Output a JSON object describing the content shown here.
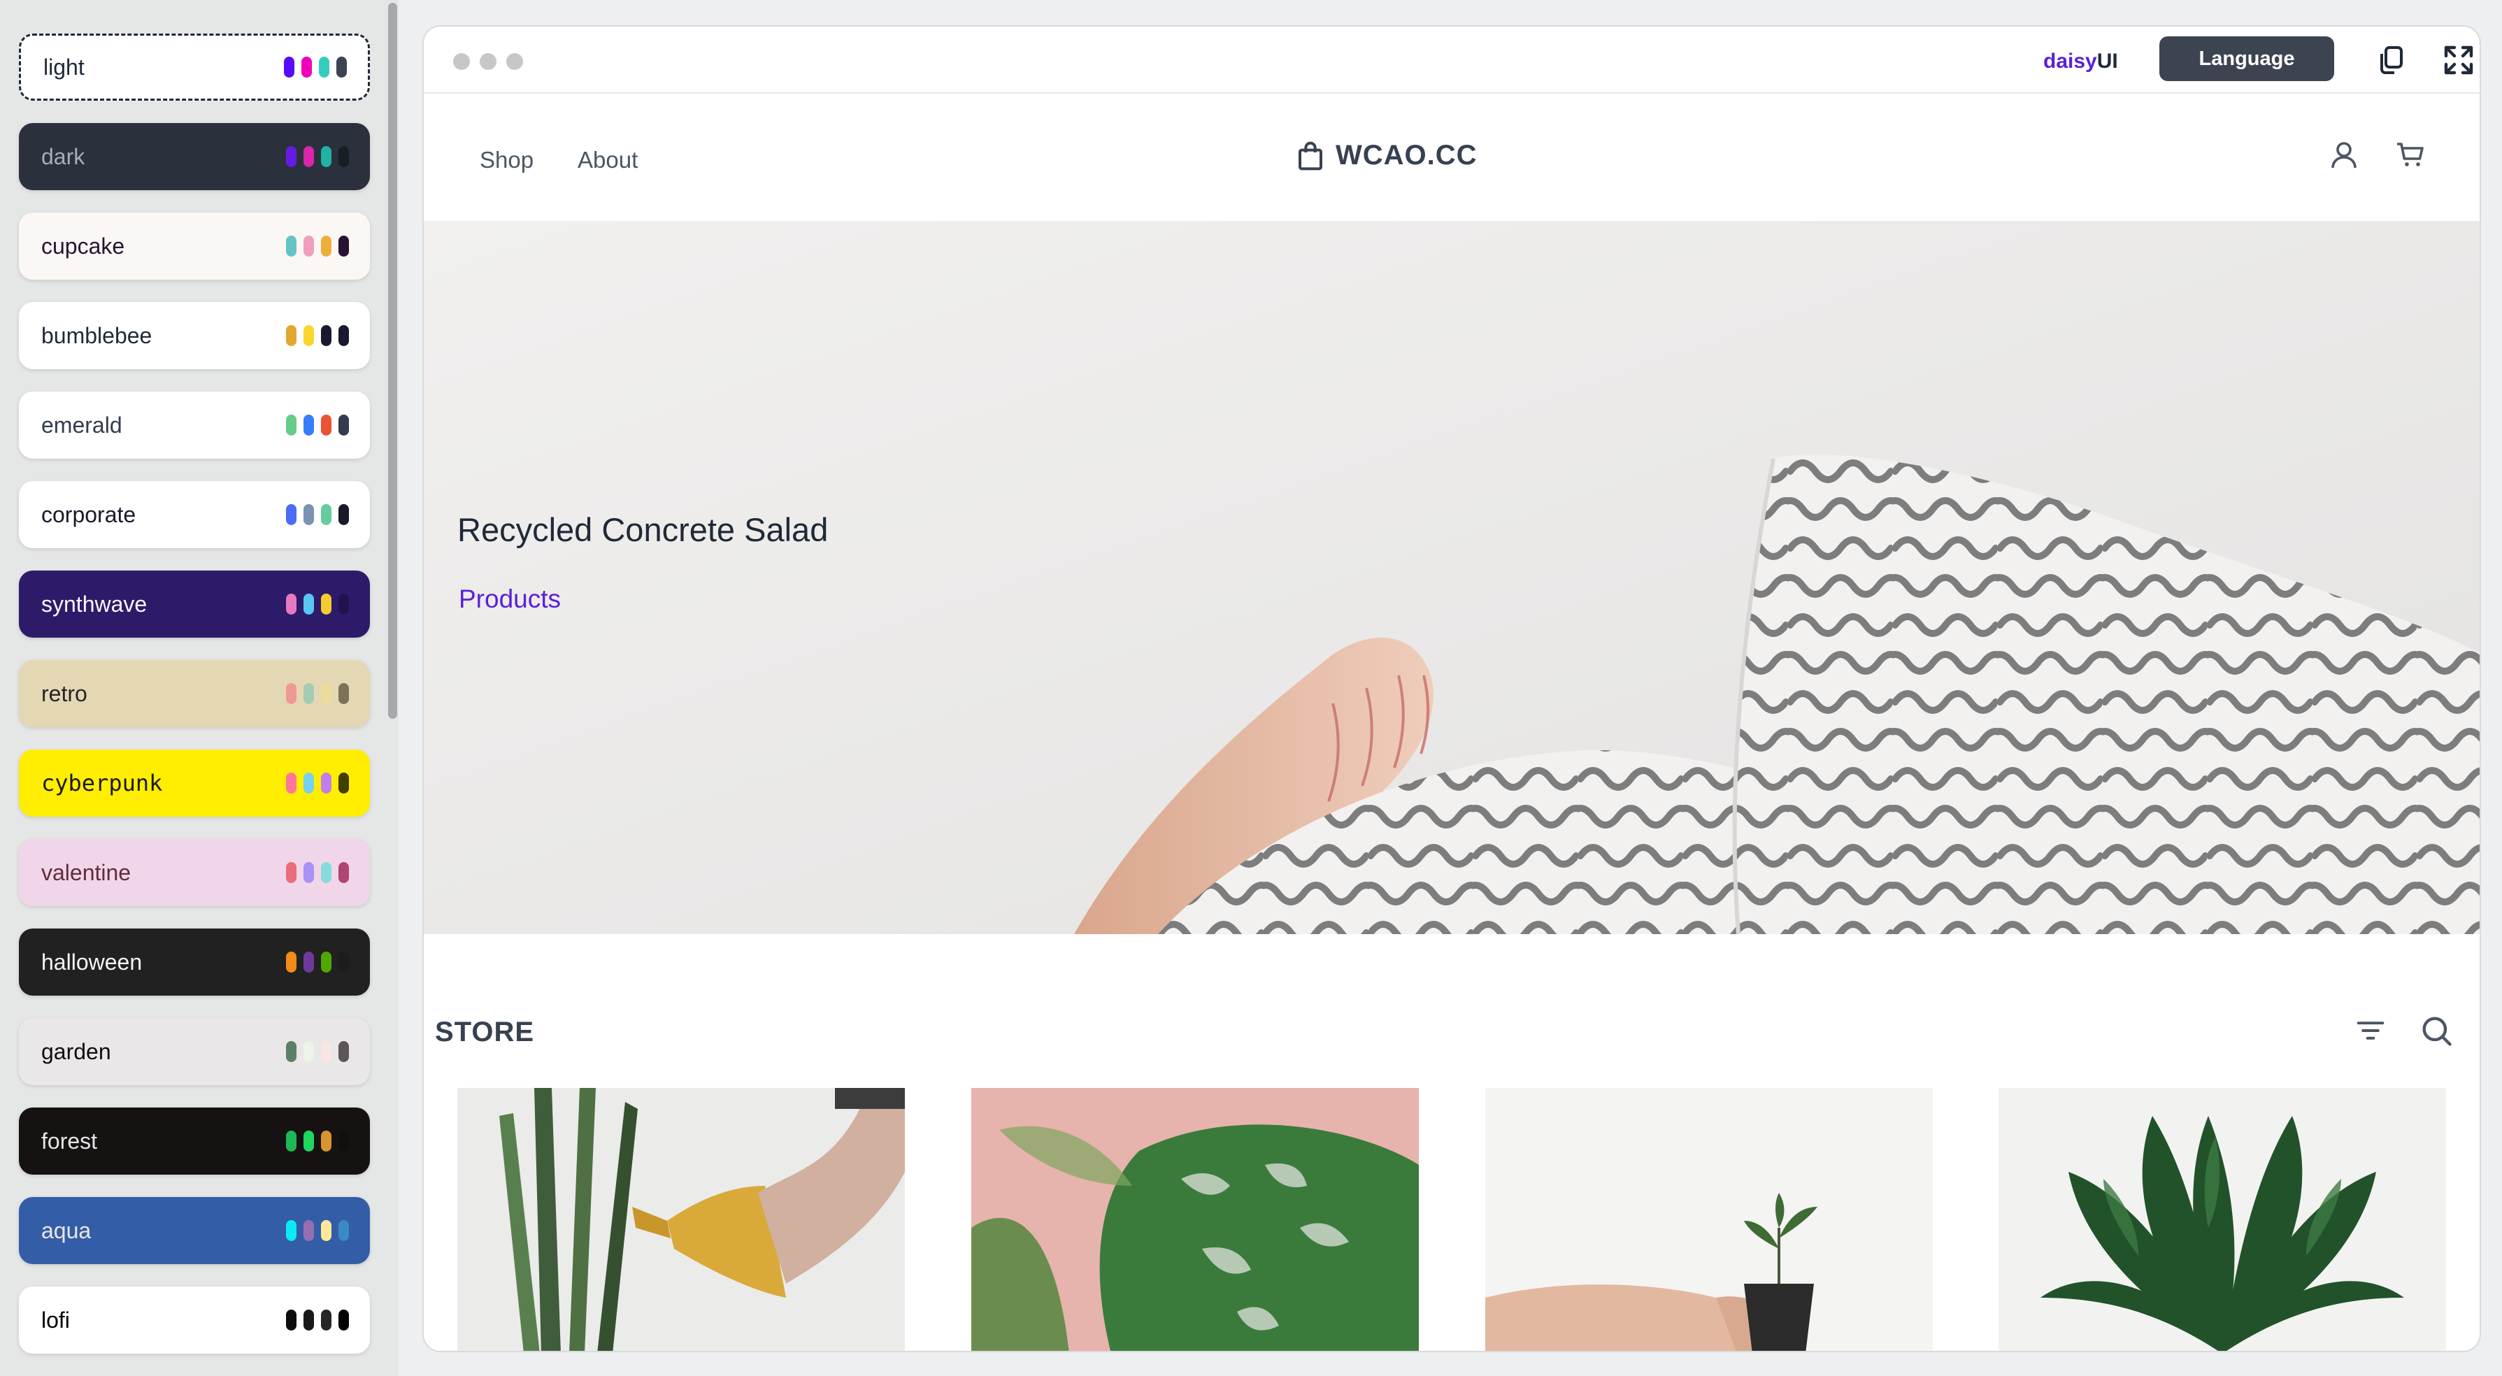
{
  "themes": [
    {
      "name": "light",
      "bg": "#ffffff",
      "fg": "#1f2937",
      "selected": true,
      "swatches": [
        "#570df8",
        "#f000b8",
        "#37cdbe",
        "#3d4451"
      ]
    },
    {
      "name": "dark",
      "bg": "#2a303c",
      "fg": "#a6adbb",
      "swatches": [
        "#661ae6",
        "#d926aa",
        "#1fb2a5",
        "#191d24"
      ]
    },
    {
      "name": "cupcake",
      "bg": "#faf7f5",
      "fg": "#291334",
      "swatches": [
        "#65c3c8",
        "#ef9fbc",
        "#eeaf3a",
        "#291334"
      ]
    },
    {
      "name": "bumblebee",
      "bg": "#ffffff",
      "fg": "#1f2937",
      "swatches": [
        "#e0a82e",
        "#f9d72f",
        "#181830",
        "#181830"
      ]
    },
    {
      "name": "emerald",
      "bg": "#ffffff",
      "fg": "#333c4d",
      "swatches": [
        "#66cc8a",
        "#377cfb",
        "#ea5234",
        "#333c4d"
      ]
    },
    {
      "name": "corporate",
      "bg": "#ffffff",
      "fg": "#181a2a",
      "swatches": [
        "#4b6bfb",
        "#7b92b2",
        "#67cba0",
        "#181a2a"
      ]
    },
    {
      "name": "synthwave",
      "bg": "#2d1b69",
      "fg": "#f9f7fd",
      "swatches": [
        "#e779c1",
        "#58c7f3",
        "#f3cc30",
        "#20134e"
      ]
    },
    {
      "name": "retro",
      "bg": "#e4d8b4",
      "fg": "#282425",
      "swatches": [
        "#ef9995",
        "#a4cbb4",
        "#ebdc99",
        "#7d7259"
      ]
    },
    {
      "name": "cyberpunk",
      "bg": "#ffee00",
      "fg": "#1a1a1a",
      "mono": true,
      "swatches": [
        "#ff7598",
        "#75d1f0",
        "#c07eec",
        "#423f00"
      ]
    },
    {
      "name": "valentine",
      "bg": "#f0d6e8",
      "fg": "#632c3b",
      "swatches": [
        "#e96d7b",
        "#a991f7",
        "#88dbdd",
        "#af4670"
      ]
    },
    {
      "name": "halloween",
      "bg": "#212121",
      "fg": "#f4f4f4",
      "swatches": [
        "#f28c18",
        "#6d3a9c",
        "#51a800",
        "#1b1d1d"
      ]
    },
    {
      "name": "garden",
      "bg": "#e9e7e7",
      "fg": "#100f0f",
      "swatches": [
        "#5c7f67",
        "#ecf4e7",
        "#fae5e5",
        "#5d5656"
      ]
    },
    {
      "name": "forest",
      "bg": "#171212",
      "fg": "#e6e6e6",
      "swatches": [
        "#1eb854",
        "#1fd65f",
        "#d99330",
        "#110e0e"
      ]
    },
    {
      "name": "aqua",
      "bg": "#345da7",
      "fg": "#e8e8e8",
      "swatches": [
        "#09ecf3",
        "#966fb3",
        "#ffe999",
        "#3b8ac4"
      ]
    },
    {
      "name": "lofi",
      "bg": "#ffffff",
      "fg": "#000000",
      "swatches": [
        "#0d0d0d",
        "#1a1919",
        "#262626",
        "#000000"
      ]
    }
  ],
  "chrome": {
    "brand_daisy": "daisy",
    "brand_ui": "UI",
    "language_label": "Language"
  },
  "nav": {
    "shop_label": "Shop",
    "about_label": "About",
    "logo_text": "WCAO.CC"
  },
  "hero": {
    "title": "Recycled Concrete Salad",
    "link_label": "Products"
  },
  "store": {
    "title": "STORE"
  },
  "colors": {
    "accent": "#5b21d6",
    "neutral": "#3d4451"
  }
}
